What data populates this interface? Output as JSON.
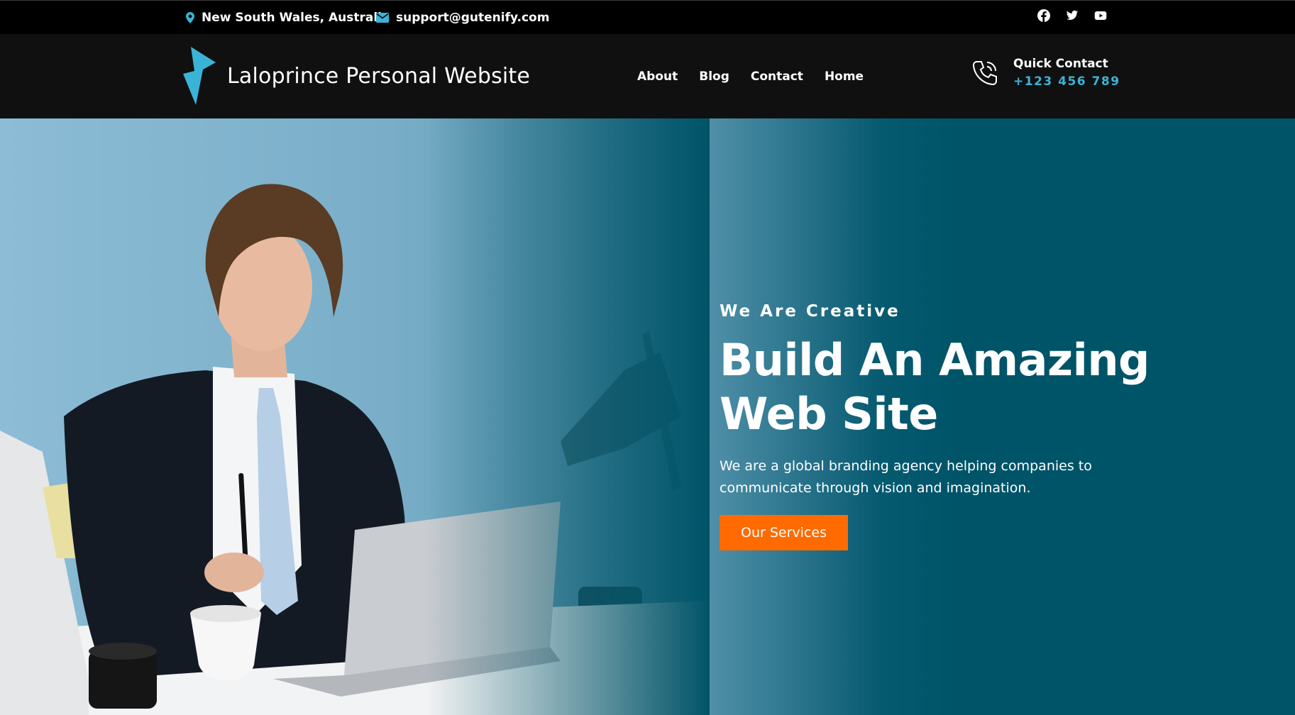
{
  "topbar": {
    "location": "New South Wales, Australia",
    "email": "support@gutenify.com",
    "social": [
      "facebook-icon",
      "twitter-icon",
      "youtube-icon"
    ]
  },
  "header": {
    "site_title": "Laloprince Personal Website",
    "nav": [
      "About",
      "Blog",
      "Contact",
      "Home"
    ],
    "quick_contact_label": "Quick Contact",
    "quick_contact_phone": "+123 456 789"
  },
  "hero": {
    "eyebrow": "We Are Creative",
    "headline_line1": "Build An Amazing",
    "headline_line2": "Web Site",
    "description": "We are a global branding agency helping companies to communicate through vision and imagination.",
    "button": "Our Services"
  },
  "colors": {
    "accent": "#3ab4d6",
    "button": "#ff6b00",
    "hero_bg": "#005468",
    "header_bg": "#101010"
  }
}
